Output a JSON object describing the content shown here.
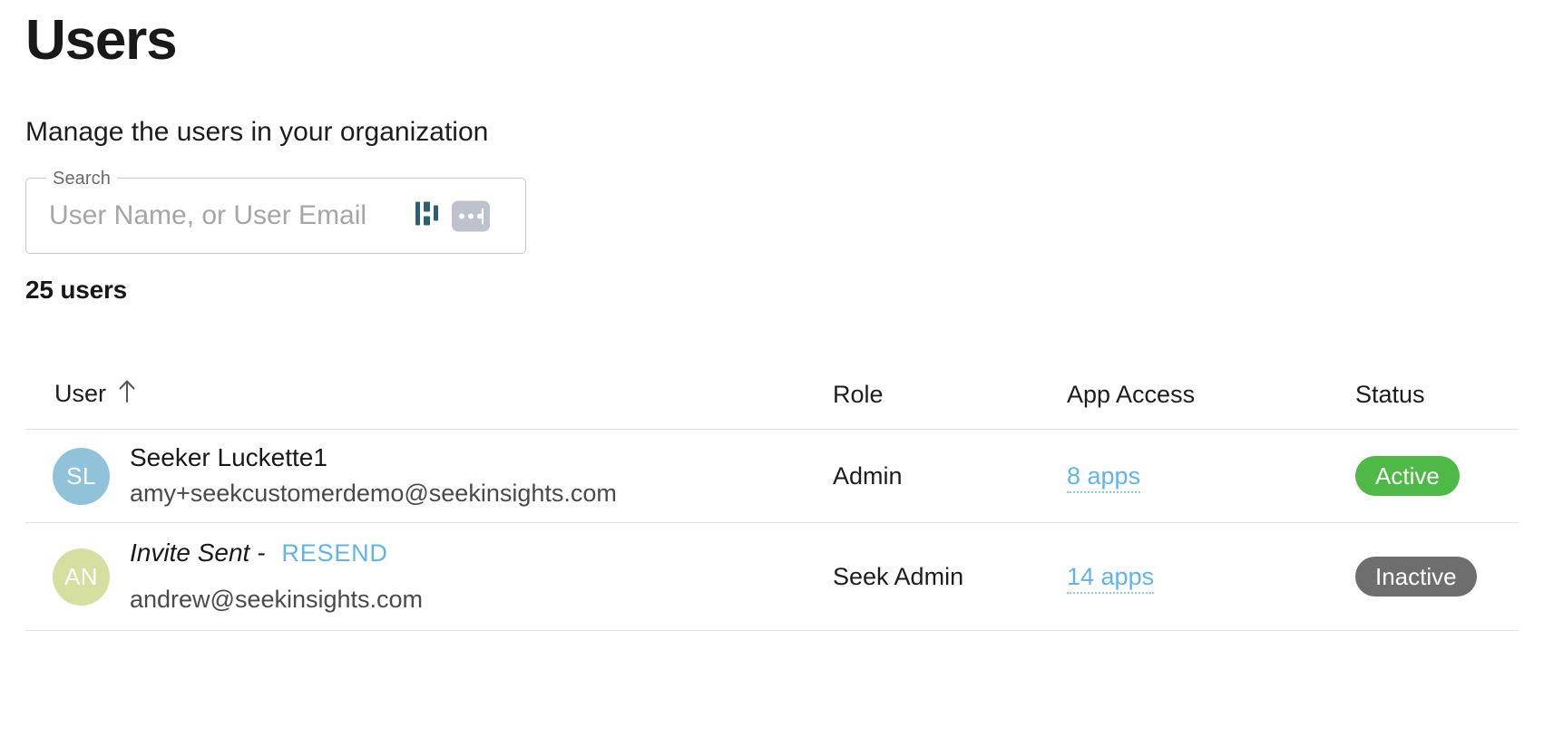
{
  "header": {
    "title": "Users",
    "subtitle": "Manage the users in your organization"
  },
  "search": {
    "label": "Search",
    "placeholder": "User Name, or User Email",
    "value": "",
    "brand_icon": "bar-glyph-icon",
    "autofill_icon": "password-autofill-icon"
  },
  "summary": {
    "count_label": "25 users"
  },
  "table": {
    "columns": [
      {
        "key": "user",
        "label": "User",
        "sort": "asc",
        "sort_icon": "arrow-up-icon"
      },
      {
        "key": "role",
        "label": "Role",
        "sort": null
      },
      {
        "key": "apps",
        "label": "App Access",
        "sort": null
      },
      {
        "key": "status",
        "label": "Status",
        "sort": null
      }
    ],
    "rows": [
      {
        "avatar": {
          "initials": "SL",
          "color": "#90c3d9"
        },
        "primary": "Seeker Luckette1",
        "is_invite": false,
        "resend_label": "",
        "email": "amy+seekcustomerdemo@seekinsights.com",
        "role": "Admin",
        "app_access": "8 apps",
        "status": "Active",
        "status_color": "#4eb947"
      },
      {
        "avatar": {
          "initials": "AN",
          "color": "#d6dfa0"
        },
        "primary": "Invite Sent -",
        "is_invite": true,
        "resend_label": "RESEND",
        "email": "andrew@seekinsights.com",
        "role": "Seek Admin",
        "app_access": "14 apps",
        "status": "Inactive",
        "status_color": "#6e6e6e"
      }
    ]
  },
  "colors": {
    "link": "#61b4ea",
    "active_green": "#4eb947",
    "inactive_gray": "#6e6e6e",
    "border": "#e3e3e3",
    "field_border": "#c9c9c9",
    "brand_teal": "#2e5f70"
  }
}
